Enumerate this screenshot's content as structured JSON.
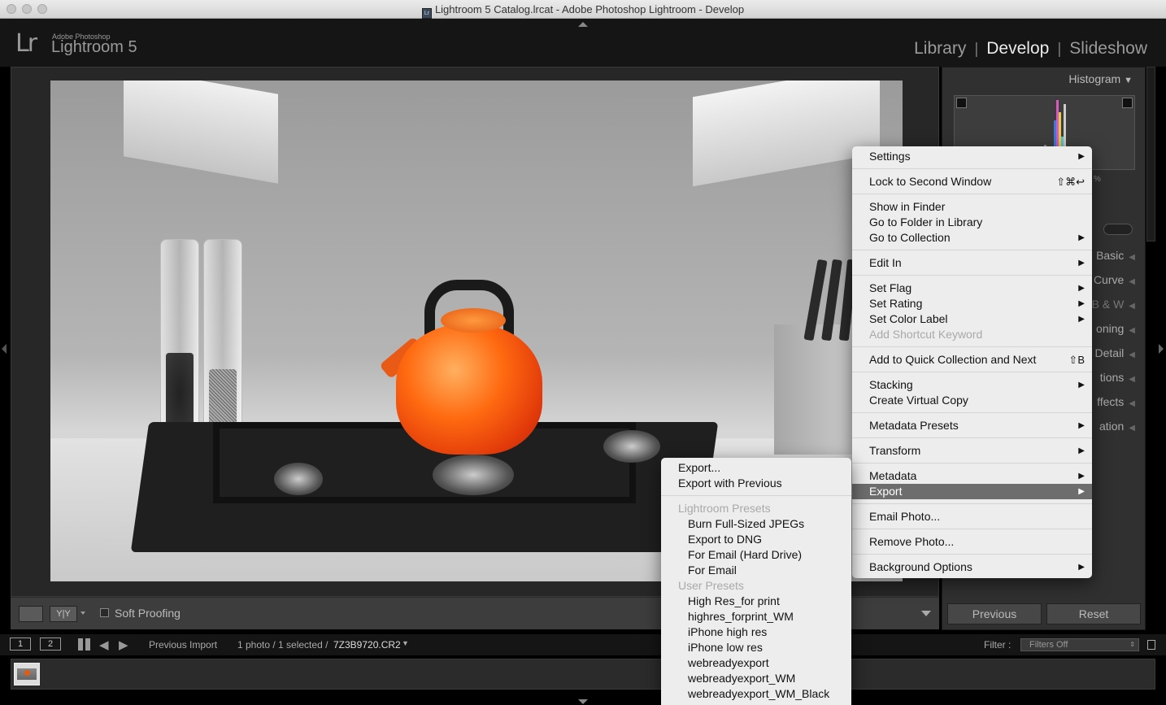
{
  "window": {
    "title": "Lightroom 5 Catalog.lrcat - Adobe Photoshop Lightroom - Develop",
    "doc_icon": "Lr"
  },
  "identity": {
    "logo": "Lr",
    "brand_small": "Adobe Photoshop",
    "brand_name": "Lightroom 5"
  },
  "modules": [
    {
      "label": "Library",
      "active": false
    },
    {
      "label": "Develop",
      "active": true
    },
    {
      "label": "Slideshow",
      "active": false
    }
  ],
  "view_toolbar": {
    "soft_proofing_label": "Soft Proofing",
    "compare_label": "Y|Y"
  },
  "right_panel": {
    "histogram_label": "Histogram",
    "stub_percent": "%",
    "panels": [
      "Basic",
      "Curve",
      "B & W",
      "oning",
      "Detail",
      "tions",
      "ffects",
      "ation"
    ],
    "previous_button": "Previous",
    "reset_button": "Reset"
  },
  "filmstrip_bar": {
    "screen1": "1",
    "screen2": "2",
    "source": "Previous Import",
    "count": "1 photo / 1 selected /",
    "filename": "7Z3B9720.CR2",
    "filter_label": "Filter :",
    "filter_value": "Filters Off"
  },
  "context_menu": {
    "settings": "Settings",
    "lock_second_window": "Lock to Second Window",
    "lock_shortcut": "⇧⌘↩",
    "show_in_finder": "Show in Finder",
    "go_to_folder": "Go to Folder in Library",
    "go_to_collection": "Go to Collection",
    "edit_in": "Edit In",
    "set_flag": "Set Flag",
    "set_rating": "Set Rating",
    "set_color_label": "Set Color Label",
    "add_shortcut_keyword": "Add Shortcut Keyword",
    "add_quick_collection": "Add to Quick Collection and Next",
    "quick_shortcut": "⇧B",
    "stacking": "Stacking",
    "create_virtual_copy": "Create Virtual Copy",
    "metadata_presets": "Metadata Presets",
    "transform": "Transform",
    "metadata": "Metadata",
    "export": "Export",
    "email_photo": "Email Photo...",
    "remove_photo": "Remove Photo...",
    "background_options": "Background Options",
    "submenu_arrow": "▶"
  },
  "export_submenu": {
    "export": "Export...",
    "export_previous": "Export with Previous",
    "lightroom_presets_header": "Lightroom Presets",
    "lightroom_presets": [
      "Burn Full-Sized JPEGs",
      "Export to DNG",
      "For Email (Hard Drive)",
      "For Email"
    ],
    "user_presets_header": "User Presets",
    "user_presets": [
      "High Res_for print",
      "highres_forprint_WM",
      "iPhone high res",
      "iPhone low res",
      "webreadyexport",
      "webreadyexport_WM",
      "webreadyexport_WM_Black"
    ]
  }
}
